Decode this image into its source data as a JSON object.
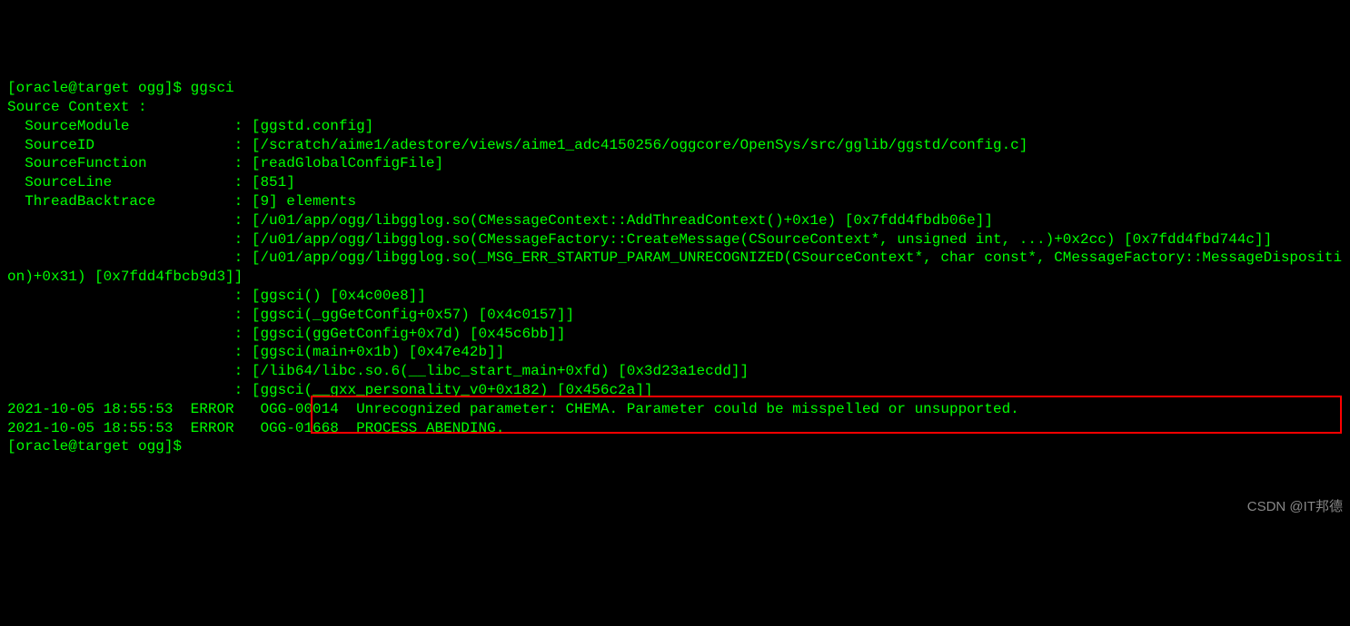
{
  "terminal": {
    "prompt_line1": "[oracle@target ogg]$ ggsci",
    "blank1": "",
    "header": "Source Context :",
    "l_module": "  SourceModule            : [ggstd.config]",
    "l_sourceid": "  SourceID                : [/scratch/aime1/adestore/views/aime1_adc4150256/oggcore/OpenSys/src/gglib/ggstd/config.c]",
    "l_function": "  SourceFunction          : [readGlobalConfigFile]",
    "l_line": "  SourceLine              : [851]",
    "l_trace": "  ThreadBacktrace         : [9] elements",
    "l_bt1": "                          : [/u01/app/ogg/libgglog.so(CMessageContext::AddThreadContext()+0x1e) [0x7fdd4fbdb06e]]",
    "l_bt2": "                          : [/u01/app/ogg/libgglog.so(CMessageFactory::CreateMessage(CSourceContext*, unsigned int, ...)+0x2cc) [0x7fdd4fbd744c]]",
    "l_bt3": "                          : [/u01/app/ogg/libgglog.so(_MSG_ERR_STARTUP_PARAM_UNRECOGNIZED(CSourceContext*, char const*, CMessageFactory::MessageDisposition)+0x31) [0x7fdd4fbcb9d3]]",
    "l_bt4": "                          : [ggsci() [0x4c00e8]]",
    "l_bt5": "                          : [ggsci(_ggGetConfig+0x57) [0x4c0157]]",
    "l_bt6": "                          : [ggsci(ggGetConfig+0x7d) [0x45c6bb]]",
    "l_bt7": "                          : [ggsci(main+0x1b) [0x47e42b]]",
    "l_bt8": "                          : [/lib64/libc.so.6(__libc_start_main+0xfd) [0x3d23a1ecdd]]",
    "l_bt9": "                          : [ggsci(__gxx_personality_v0+0x182) [0x456c2a]]",
    "blank2": "",
    "err1": "2021-10-05 18:55:53  ERROR   OGG-00014  Unrecognized parameter: CHEMA. Parameter could be misspelled or unsupported.",
    "blank3": "",
    "err2": "2021-10-05 18:55:53  ERROR   OGG-01668  PROCESS ABENDING.",
    "prompt_line2": "[oracle@target ogg]$"
  },
  "watermark": "CSDN @IT邦德"
}
